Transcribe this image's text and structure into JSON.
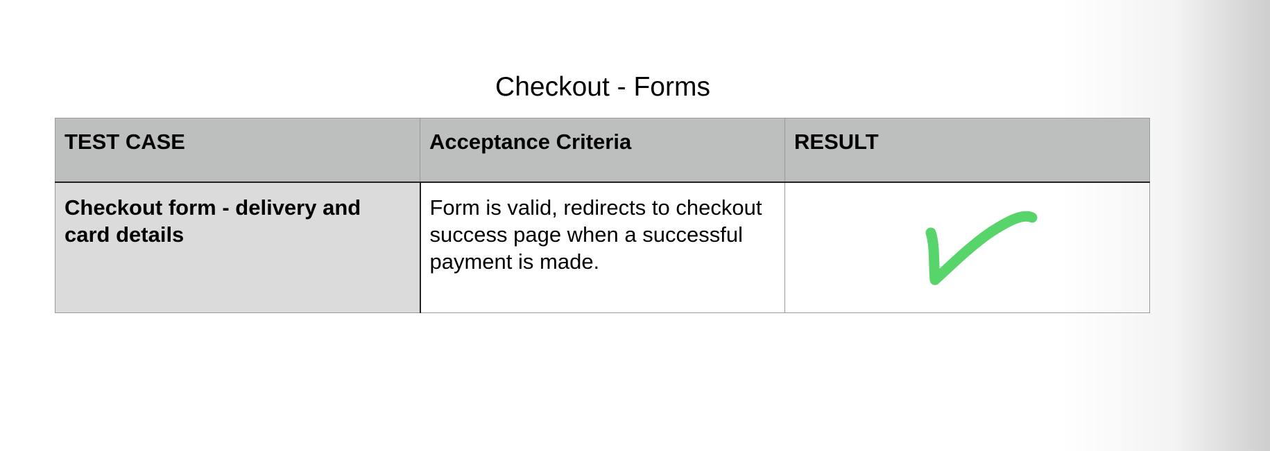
{
  "document": {
    "title": "Checkout - Forms"
  },
  "table": {
    "headers": {
      "test_case": "TEST CASE",
      "criteria": "Acceptance Criteria",
      "result": "RESULT"
    },
    "rows": [
      {
        "test_case": "Checkout form - delivery and card details",
        "criteria": "Form is valid, redirects to checkout success page when a successful payment is made.",
        "result_icon": "green-check-icon",
        "result_color": "#57d46a"
      }
    ]
  }
}
